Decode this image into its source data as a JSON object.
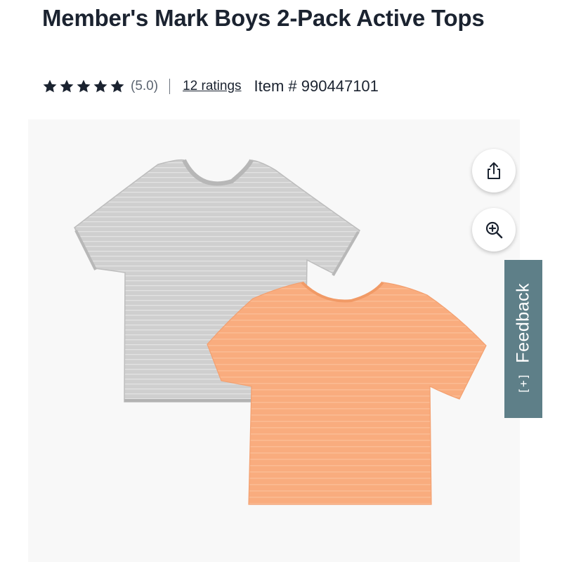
{
  "product": {
    "title": "Member's Mark Boys 2-Pack Active Tops",
    "rating_value": 5.0,
    "rating_text": "(5.0)",
    "stars_filled": 5,
    "stars_total": 5,
    "ratings_link": "12 ratings",
    "item_number": "Item # 990447101"
  },
  "image": {
    "shirts": [
      {
        "color_name": "heather gray",
        "color": "#cfcfcf"
      },
      {
        "color_name": "peach",
        "color": "#f9ac7e"
      }
    ]
  },
  "actions": {
    "share_icon": "share-icon",
    "zoom_icon": "zoom-in-icon"
  },
  "feedback": {
    "label": "Feedback",
    "icon_text": "[+]",
    "color": "#5e7f88"
  },
  "colors": {
    "text": "#1b2330",
    "muted": "#5b6470"
  }
}
